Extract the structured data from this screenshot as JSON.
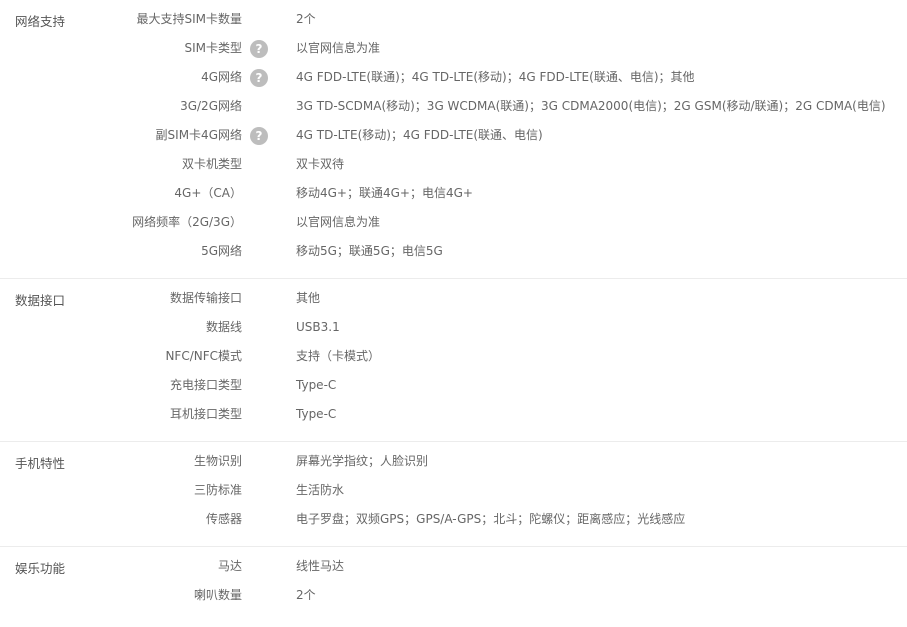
{
  "groups": [
    {
      "title": "网络支持",
      "rows": [
        {
          "label": "最大支持SIM卡数量",
          "value": "2个",
          "help": false
        },
        {
          "label": "SIM卡类型",
          "value": "以官网信息为准",
          "help": true
        },
        {
          "label": "4G网络",
          "value": "4G FDD-LTE(联通)；4G TD-LTE(移动)；4G FDD-LTE(联通、电信)；其他",
          "help": true
        },
        {
          "label": "3G/2G网络",
          "value": "3G TD-SCDMA(移动)；3G WCDMA(联通)；3G CDMA2000(电信)；2G GSM(移动/联通)；2G CDMA(电信)",
          "help": false
        },
        {
          "label": "副SIM卡4G网络",
          "value": "4G TD-LTE(移动)；4G FDD-LTE(联通、电信)",
          "help": true
        },
        {
          "label": "双卡机类型",
          "value": "双卡双待",
          "help": false
        },
        {
          "label": "4G+（CA）",
          "value": "移动4G+；联通4G+；电信4G+",
          "help": false
        },
        {
          "label": "网络频率（2G/3G）",
          "value": "以官网信息为准",
          "help": false
        },
        {
          "label": "5G网络",
          "value": "移动5G；联通5G；电信5G",
          "help": false
        }
      ]
    },
    {
      "title": "数据接口",
      "rows": [
        {
          "label": "数据传输接口",
          "value": "其他",
          "help": false
        },
        {
          "label": "数据线",
          "value": "USB3.1",
          "help": false
        },
        {
          "label": "NFC/NFC模式",
          "value": "支持（卡模式）",
          "help": false
        },
        {
          "label": "充电接口类型",
          "value": "Type-C",
          "help": false
        },
        {
          "label": "耳机接口类型",
          "value": "Type-C",
          "help": false
        }
      ]
    },
    {
      "title": "手机特性",
      "rows": [
        {
          "label": "生物识别",
          "value": "屏幕光学指纹；人脸识别",
          "help": false
        },
        {
          "label": "三防标准",
          "value": "生活防水",
          "help": false
        },
        {
          "label": "传感器",
          "value": "电子罗盘；双频GPS；GPS/A-GPS；北斗；陀螺仪；距离感应；光线感应",
          "help": false
        }
      ]
    },
    {
      "title": "娱乐功能",
      "rows": [
        {
          "label": "马达",
          "value": "线性马达",
          "help": false
        },
        {
          "label": "喇叭数量",
          "value": "2个",
          "help": false
        }
      ]
    }
  ],
  "help_icon_glyph": "?",
  "help_icon_name": "question-circle-icon"
}
